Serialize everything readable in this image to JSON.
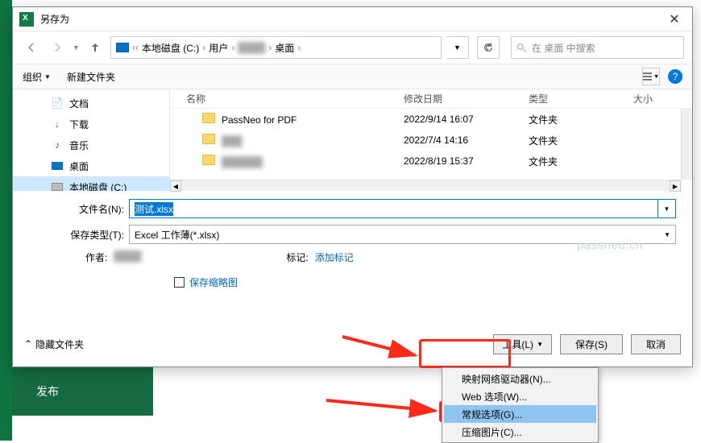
{
  "title": "另存为",
  "breadcrumb": {
    "drive": "本地磁盘 (C:)",
    "users": "用户",
    "desktop": "桌面"
  },
  "search_placeholder": "在 桌面 中搜索",
  "toolbar": {
    "organize": "组织",
    "newfolder": "新建文件夹"
  },
  "tree": {
    "docs": "文档",
    "downloads": "下载",
    "music": "音乐",
    "desktop": "桌面",
    "drive_c": "本地磁盘 (C:)"
  },
  "columns": {
    "name": "名称",
    "date": "修改日期",
    "type": "类型",
    "size": "大小"
  },
  "rows": [
    {
      "name": "PassNeo for PDF",
      "date": "2022/9/14 16:07",
      "type": "文件夹"
    },
    {
      "name": "",
      "date": "2022/7/4 14:16",
      "type": "文件夹"
    },
    {
      "name": "",
      "date": "2022/8/19 15:37",
      "type": "文件夹"
    }
  ],
  "form": {
    "filename_label": "文件名(N):",
    "filename_value": "测试.xlsx",
    "filetype_label": "保存类型(T):",
    "filetype_value": "Excel 工作薄(*.xlsx)",
    "author_label": "作者:",
    "tags_label": "标记:",
    "tags_link": "添加标记",
    "save_thumb": "保存缩略图"
  },
  "footer": {
    "hide_folders": "隐藏文件夹",
    "tools": "工具(L)",
    "save": "保存(S)",
    "cancel": "取消"
  },
  "menu": {
    "map_drive": "映射网络驱动器(N)...",
    "web_options": "Web 选项(W)...",
    "general_options": "常规选项(G)...",
    "compress_pic": "压缩图片(C)..."
  },
  "publish": "发布",
  "watermark": "passneo.cn"
}
